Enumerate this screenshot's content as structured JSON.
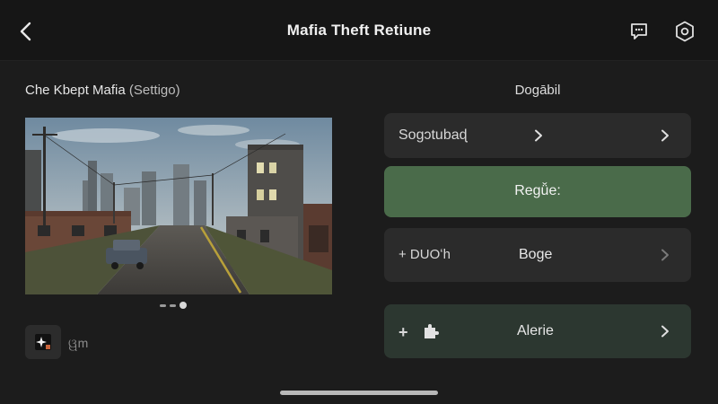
{
  "header": {
    "title": "Mafia Theft Retiune",
    "back_icon": "chevron-left-icon",
    "chat_icon": "chat-icon",
    "settings_icon": "gear-icon"
  },
  "left": {
    "title": "Che Kbept Mafia",
    "subtitle": "(Settigo)",
    "thumb_label": "ୱm"
  },
  "right": {
    "title": "Dogābil",
    "options": [
      {
        "label": "Sogɔtubaɖ"
      },
      {
        "label": "Regǚe:"
      },
      {
        "prefix": "+ DUOʻh",
        "label": "Boge"
      },
      {
        "prefix": "+",
        "label": "Alerie"
      }
    ]
  },
  "colors": {
    "background": "#1c1c1c",
    "accent_green": "#4a6b4a",
    "dark_green": "#2c3730",
    "panel": "#2b2b2b"
  }
}
